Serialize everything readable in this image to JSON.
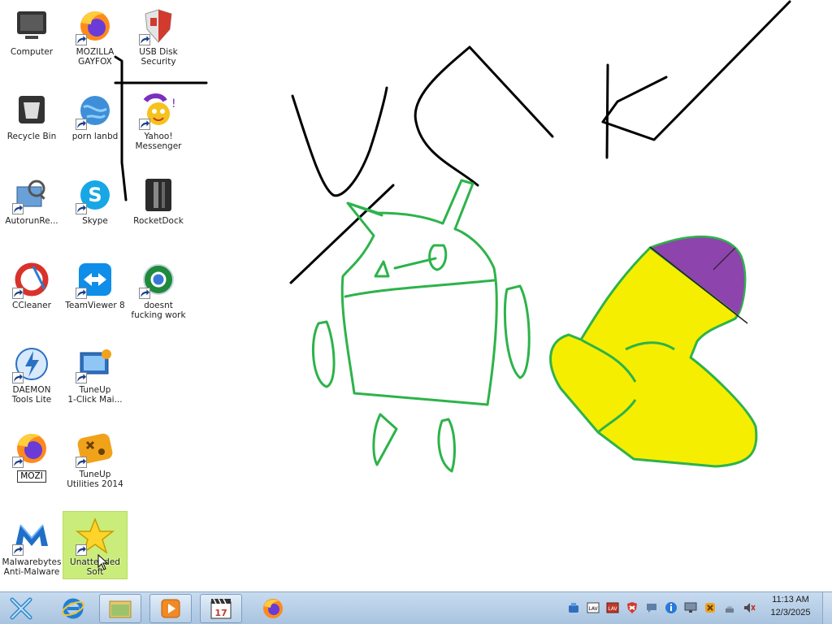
{
  "desktop": {
    "icons": [
      {
        "label": "Computer",
        "icon": "computer-icon",
        "shortcut": false
      },
      {
        "label": "MOZILLA\nGAYFOX",
        "icon": "firefox-icon",
        "shortcut": true
      },
      {
        "label": "USB Disk\nSecurity",
        "icon": "shield-icon",
        "shortcut": true
      },
      {
        "label": "Recycle Bin",
        "icon": "recycle-bin-icon",
        "shortcut": false
      },
      {
        "label": "porn lanbd",
        "icon": "globe-icon",
        "shortcut": true
      },
      {
        "label": "Yahoo!\nMessenger",
        "icon": "yahoo-messenger-icon",
        "shortcut": true
      },
      {
        "label": "AutorunRe...",
        "icon": "autorun-icon",
        "shortcut": true
      },
      {
        "label": "Skype",
        "icon": "skype-icon",
        "shortcut": true
      },
      {
        "label": "RocketDock",
        "icon": "rocketdock-icon",
        "shortcut": false
      },
      {
        "label": "CCleaner",
        "icon": "ccleaner-icon",
        "shortcut": true
      },
      {
        "label": "TeamViewer 8",
        "icon": "teamviewer-icon",
        "shortcut": true
      },
      {
        "label": "doesnt\nfucking work",
        "icon": "chrome-icon",
        "shortcut": true
      },
      {
        "label": "DAEMON\nTools Lite",
        "icon": "daemon-tools-icon",
        "shortcut": true
      },
      {
        "label": "TuneUp\n1-Click Mai...",
        "icon": "tuneup-1click-icon",
        "shortcut": true
      },
      {
        "label": "MOZI",
        "icon": "firefox-icon",
        "shortcut": true,
        "renaming": true
      },
      {
        "label": "TuneUp\nUtilities 2014",
        "icon": "tuneup-utilities-icon",
        "shortcut": true
      },
      {
        "label": "Malwarebytes\nAnti-Malware",
        "icon": "malwarebytes-icon",
        "shortcut": true
      },
      {
        "label": "Unattended\nSoft",
        "icon": "star-icon",
        "shortcut": true,
        "selected": true
      }
    ]
  },
  "taskbar": {
    "start_icon": "start-button-icon",
    "pinned": [
      {
        "name": "internet-explorer-icon"
      },
      {
        "name": "file-explorer-icon"
      },
      {
        "name": "media-player-icon"
      },
      {
        "name": "media-player-classic-icon"
      },
      {
        "name": "firefox-icon"
      }
    ],
    "tray": [
      "network-icon",
      "lav-audio-icon",
      "lav-video-icon",
      "shield-tray-icon",
      "chat-icon",
      "info-icon",
      "display-icon",
      "tuneup-tray-icon",
      "wifi-icon",
      "volume-icon"
    ],
    "clock": {
      "time": "11:13 AM",
      "date": "12/3/2025"
    }
  },
  "colors": {
    "taskbar": "#b9d0e8",
    "android_green": "#2db34a",
    "pacman_yellow": "#f6ee00",
    "purple": "#8e44ad",
    "selection": "#c9ec7a"
  }
}
